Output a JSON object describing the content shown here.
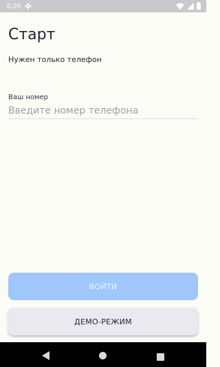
{
  "status_bar": {
    "time": "6:26"
  },
  "screen": {
    "title": "Старт",
    "subtitle": "Нужен только телефон"
  },
  "phone_field": {
    "label": "Ваш номер",
    "value": "",
    "placeholder": "Введите номер телефона"
  },
  "buttons": {
    "login_label": "ВОЙТИ",
    "demo_label": "ДЕМО-РЕЖИМ"
  },
  "colors": {
    "background": "#fcfcf6",
    "primary_disabled": "#9fc7fb",
    "secondary_button": "#e9e9ef",
    "status_bar": "#c9c9c9",
    "nav_bar": "#000000"
  },
  "icons": {
    "status_left": [
      "gear-icon"
    ],
    "status_right": [
      "wifi-icon",
      "cellular-signal-icon",
      "battery-icon"
    ],
    "nav": [
      "back-icon",
      "home-icon",
      "recents-icon"
    ]
  }
}
